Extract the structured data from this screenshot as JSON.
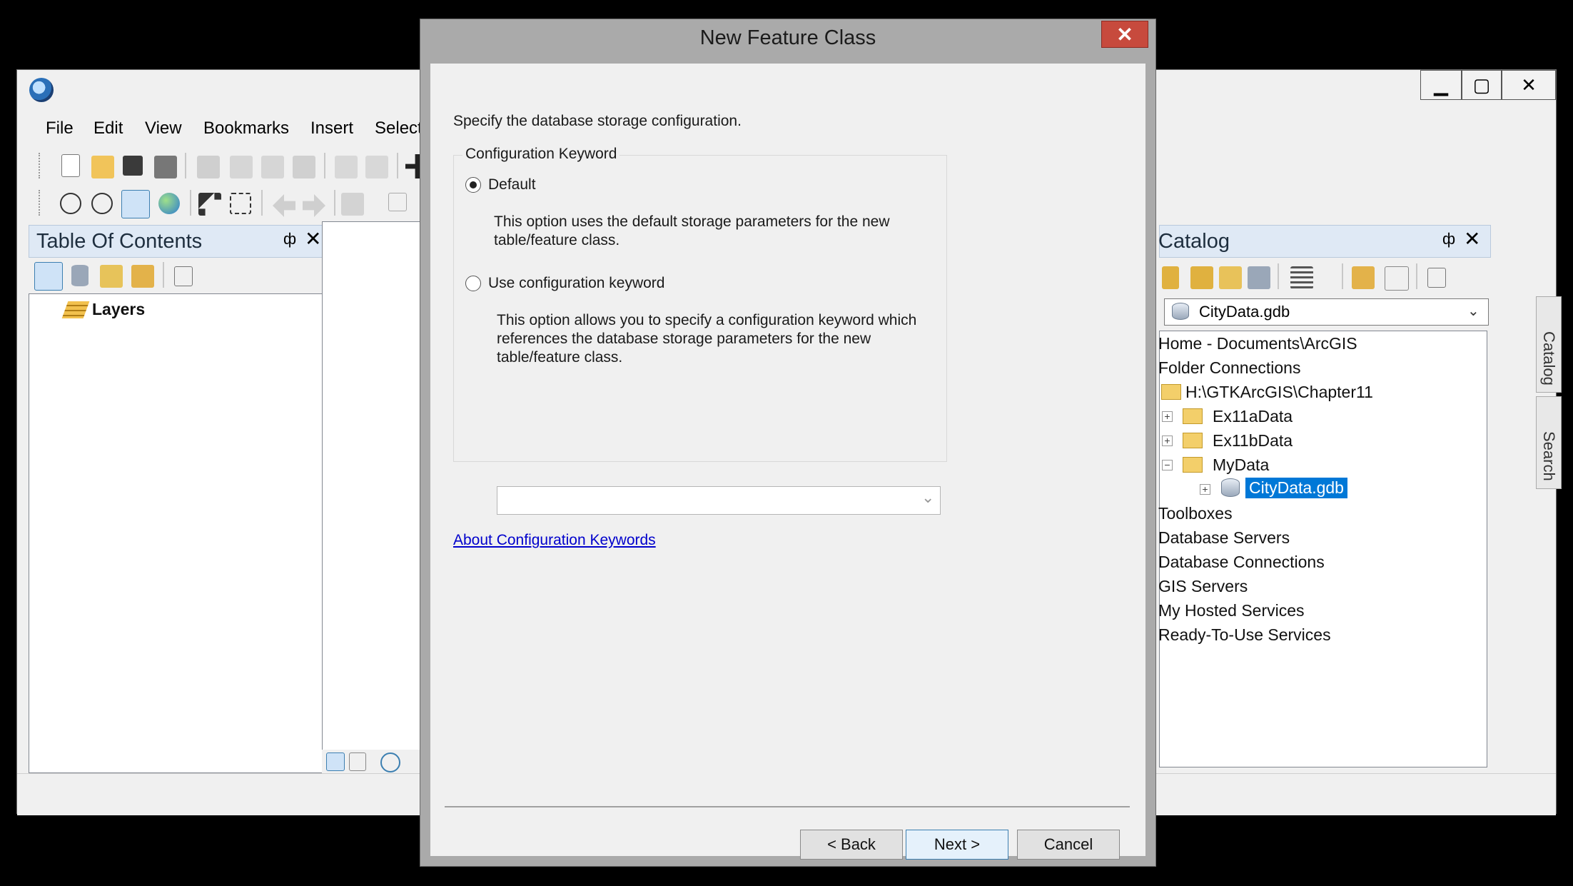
{
  "main_window": {
    "menu": [
      "File",
      "Edit",
      "View",
      "Bookmarks",
      "Insert",
      "Selection"
    ],
    "toc": {
      "title": "Table Of Contents",
      "pin_glyph": "ф",
      "close_glyph": "✕",
      "root_item": "Layers"
    },
    "window_buttons": {
      "minimize": "▁",
      "maximize": "▢",
      "close": "✕"
    }
  },
  "catalog": {
    "title": "Catalog",
    "location": "CityData.gdb",
    "tree": [
      {
        "label": "Home - Documents\\ArcGIS"
      },
      {
        "label": "Folder Connections"
      },
      {
        "label": "H:\\GTKArcGIS\\Chapter11"
      },
      {
        "label": "Ex11aData"
      },
      {
        "label": "Ex11bData"
      },
      {
        "label": "MyData"
      },
      {
        "label": "CityData.gdb"
      },
      {
        "label": "Toolboxes"
      },
      {
        "label": "Database Servers"
      },
      {
        "label": "Database Connections"
      },
      {
        "label": "GIS Servers"
      },
      {
        "label": "My Hosted Services"
      },
      {
        "label": "Ready-To-Use Services"
      }
    ],
    "side_tabs": [
      "Catalog",
      "Search"
    ]
  },
  "dialog": {
    "title": "New Feature Class",
    "close_glyph": "✕",
    "instruction": "Specify the database storage configuration.",
    "group_label": "Configuration Keyword",
    "option_default": "Default",
    "option_default_desc": "This option uses the default storage parameters for the new table/feature class.",
    "option_keyword": "Use configuration keyword",
    "option_keyword_desc": "This option allows you to specify a configuration keyword which references the database storage parameters for the new table/feature class.",
    "keyword_value": "",
    "link": "About Configuration Keywords",
    "buttons": {
      "back": "< Back",
      "next": "Next >",
      "cancel": "Cancel"
    }
  }
}
